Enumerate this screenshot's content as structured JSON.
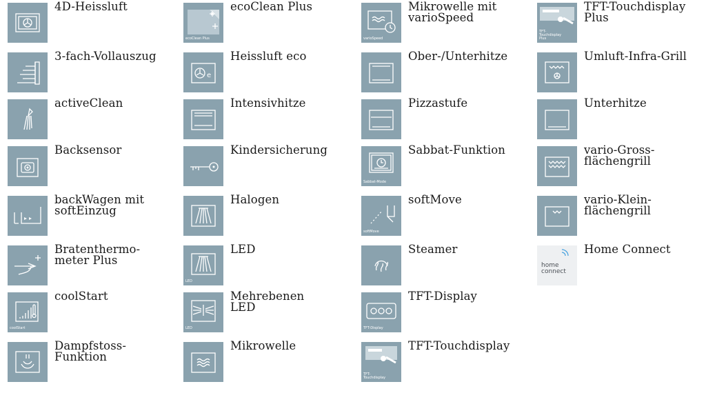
{
  "features": [
    {
      "label": "4D-Heissluft",
      "icon": "fan-heat-icon"
    },
    {
      "label": "3-fach-Vollauszug",
      "icon": "telescopic-rails-icon"
    },
    {
      "label": "activeClean",
      "icon": "active-clean-icon"
    },
    {
      "label": "Backsensor",
      "icon": "baking-sensor-icon"
    },
    {
      "label": "backWagen mit\nsoftEinzug",
      "icon": "baking-trolley-icon"
    },
    {
      "label": "Bratenthermo-\nmeter Plus",
      "icon": "meat-probe-icon"
    },
    {
      "label": "coolStart",
      "icon": "cool-start-icon",
      "small": "coolStart"
    },
    {
      "label": "Dampfstoss-\nFunktion",
      "icon": "steam-burst-icon"
    },
    {
      "label": "ecoClean Plus",
      "icon": "eco-clean-icon",
      "small": "ecoClean Plus"
    },
    {
      "label": "Heissluft eco",
      "icon": "fan-eco-icon"
    },
    {
      "label": "Intensivhitze",
      "icon": "intensive-heat-icon"
    },
    {
      "label": "Kindersicherung",
      "icon": "key-lock-icon"
    },
    {
      "label": "Halogen",
      "icon": "halogen-light-icon"
    },
    {
      "label": "LED",
      "icon": "led-light-icon",
      "small": "LED"
    },
    {
      "label": "Mehrebenen\nLED",
      "icon": "multi-level-led-icon",
      "small": "LED"
    },
    {
      "label": "Mikrowelle",
      "icon": "microwave-icon"
    },
    {
      "label": "Mikrowelle mit\nvarioSpeed",
      "icon": "microwave-variospeed-icon",
      "small": "varioSpeed"
    },
    {
      "label": "Ober-/Unterhitze",
      "icon": "top-bottom-heat-icon"
    },
    {
      "label": "Pizzastufe",
      "icon": "pizza-setting-icon"
    },
    {
      "label": "Sabbat-Funktion",
      "icon": "sabbath-clock-icon",
      "small": "Sabbat-Mode"
    },
    {
      "label": "softMove",
      "icon": "soft-move-icon",
      "small": "softMove"
    },
    {
      "label": "Steamer",
      "icon": "steamer-icon"
    },
    {
      "label": "TFT-Display",
      "icon": "tft-display-icon",
      "small": "TFT-Display"
    },
    {
      "label": "TFT-Touchdisplay",
      "icon": "touch-display-icon",
      "small": "TFT-\nTouchdisplay"
    },
    {
      "label": "TFT-Touchdisplay\nPlus",
      "icon": "touch-display-plus-icon",
      "small": "TFT-\nTouchdisplay\nPlus"
    },
    {
      "label": "Umluft-Infra-Grill",
      "icon": "convection-grill-icon"
    },
    {
      "label": "Unterhitze",
      "icon": "bottom-heat-icon"
    },
    {
      "label": "vario-Gross-\nflächengrill",
      "icon": "large-grill-icon"
    },
    {
      "label": "vario-Klein-\nflächengrill",
      "icon": "small-grill-icon"
    },
    {
      "label": "Home Connect",
      "icon": "home-connect-logo-icon",
      "logo": "home\nconnect"
    }
  ]
}
